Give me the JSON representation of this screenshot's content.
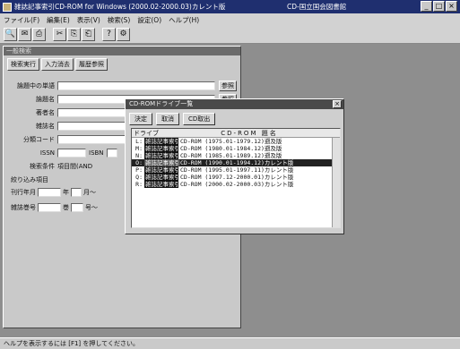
{
  "window": {
    "title": "雑誌記事索引CD-ROM for Windows (2000.02-2000.03)カレント版",
    "center": "CD-国立国会図書館",
    "controls": [
      "_",
      "□",
      "×"
    ]
  },
  "menu": [
    "ファイル(F)",
    "編集(E)",
    "表示(V)",
    "検索(S)",
    "設定(O)",
    "ヘルプ(H)"
  ],
  "toolbar": [
    "🔍",
    "✉",
    "⎙",
    "✂",
    "⎘",
    "⎗",
    "?",
    "⚙"
  ],
  "panel": {
    "title": "一般検索",
    "tabs": [
      "検索実行",
      "入力消去",
      "履歴参照"
    ],
    "fields": [
      {
        "label": "論題中の単語",
        "ref": "参照"
      },
      {
        "label": "論題名",
        "ref": "参照"
      },
      {
        "label": "著者名",
        "ref": ""
      },
      {
        "label": "雑誌名",
        "ref": ""
      },
      {
        "label": "分類コード",
        "ref": ""
      }
    ],
    "issn_label": "ISSN",
    "isbn_label": "ISBN",
    "cond_label": "検索条件",
    "cond_value": "項目間(AND",
    "narrow": "絞り込み項目",
    "date_label": "刊行年月",
    "year": "年",
    "month": "月～",
    "num_label": "雑誌巻号",
    "vol": "巻",
    "issue": "号～"
  },
  "dialog": {
    "title": "CD-ROMドライブ一覧",
    "close": "×",
    "buttons": [
      "決定",
      "取消",
      "CD取出"
    ],
    "head_drive": "ドライブ",
    "head_name": "CD-ROM 題名",
    "rows": [
      {
        "d": "L:",
        "n": "雑誌記事索引",
        "t": "CD-ROM (1975.01-1979.12)遡及版"
      },
      {
        "d": "M:",
        "n": "雑誌記事索引",
        "t": "CD-ROM (1980.01-1984.12)遡及版"
      },
      {
        "d": "N:",
        "n": "雑誌記事索引",
        "t": "CD-ROM (1985.01-1989.12)遡及版"
      },
      {
        "d": "O:",
        "n": "雑誌記事索引",
        "t": "CD-ROM (1990.01-1994.12)カレント版",
        "sel": true
      },
      {
        "d": "P:",
        "n": "雑誌記事索引",
        "t": "CD-ROM (1995.01-1997.11)カレント版"
      },
      {
        "d": "Q:",
        "n": "雑誌記事索引",
        "t": "CD-ROM (1997.12-2000.01)カレント版"
      },
      {
        "d": "R:",
        "n": "雑誌記事索引",
        "t": "CD-ROM (2000.02-2000.03)カレント版"
      }
    ]
  },
  "status": "ヘルプを表示するには [F1] を押してください。"
}
